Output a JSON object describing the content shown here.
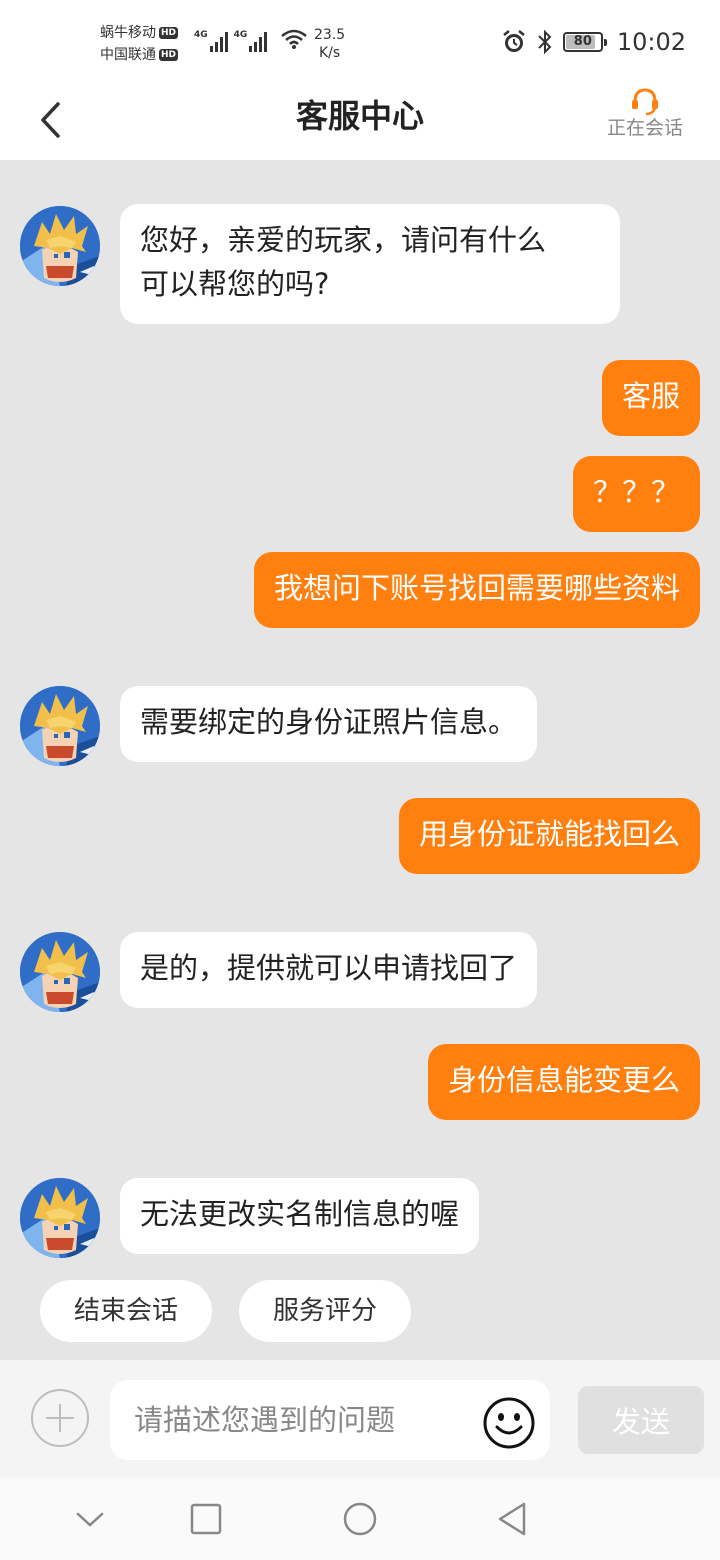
{
  "status_bar": {
    "carrier_1": "蜗牛移动",
    "carrier_2": "中国联通",
    "hd_label": "HD",
    "network_type": "4G",
    "speed_value": "23.5",
    "speed_unit": "K/s",
    "battery_percent": "80",
    "time": "10:02"
  },
  "header": {
    "title": "客服中心",
    "session_status": "正在会话"
  },
  "messages": [
    {
      "from": "agent",
      "text": "您好，亲爱的玩家，请问有什么"
    },
    {
      "from": "agent",
      "text": "可以帮您的吗?"
    },
    {
      "from": "user",
      "text": "客服"
    },
    {
      "from": "user",
      "text": "？？？"
    },
    {
      "from": "user",
      "text": "我想问下账号找回需要哪些资料"
    },
    {
      "from": "agent",
      "text": "需要绑定的身份证照片信息。"
    },
    {
      "from": "user",
      "text": "用身份证就能找回么"
    },
    {
      "from": "agent",
      "text": "是的，提供就可以申请找回了"
    },
    {
      "from": "user",
      "text": "身份信息能变更么"
    },
    {
      "from": "agent",
      "text": "无法更改实名制信息的喔"
    }
  ],
  "quick_actions": {
    "end_session": "结束会话",
    "rate_service": "服务评分"
  },
  "input_bar": {
    "placeholder": "请描述您遇到的问题",
    "send_label": "发送"
  },
  "colors": {
    "accent": "#ff7f0f",
    "chat_bg": "#e5e5e5",
    "agent_bubble": "#ffffff"
  },
  "icons": {
    "back": "chevron-left-icon",
    "session": "headset-icon",
    "add": "plus-icon",
    "emoji": "smiley-icon",
    "nav": [
      "chevron-down-icon",
      "square-icon",
      "circle-icon",
      "triangle-back-icon"
    ]
  }
}
